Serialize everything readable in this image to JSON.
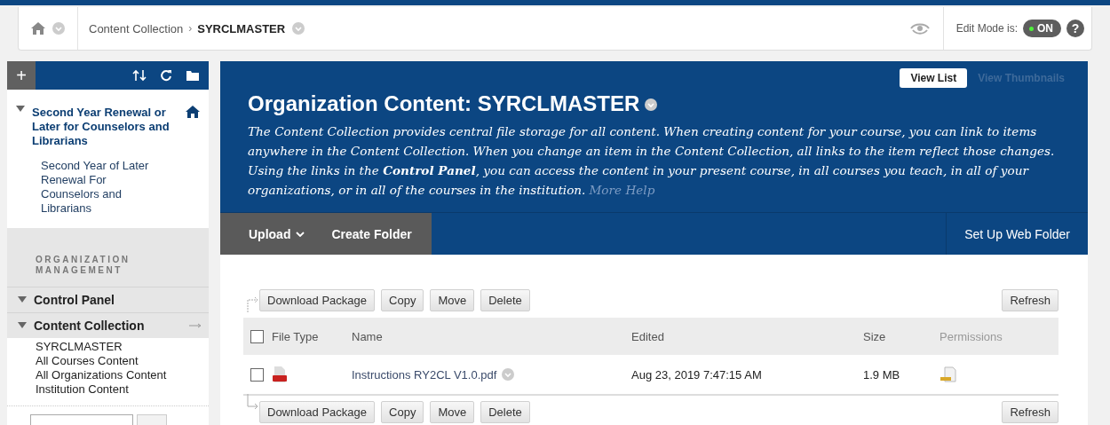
{
  "breadcrumb": {
    "items": [
      "Content Collection",
      "SYRCLMASTER"
    ],
    "separator": "›"
  },
  "edit_mode": {
    "label": "Edit Mode is:",
    "value": "ON",
    "on": true
  },
  "help": "?",
  "sidebar": {
    "add": "+",
    "course": {
      "title": "Second Year Renewal or Later for Counselors and Librarians",
      "expanded": true,
      "link": "Second Year of Later Renewal For Counselors and Librarians"
    },
    "section_label": "ORGANIZATION MANAGEMENT",
    "menus": [
      {
        "label": "Control Panel",
        "expanded": true
      },
      {
        "label": "Content Collection",
        "expanded": true,
        "children": [
          "SYRCLMASTER",
          "All Courses Content",
          "All Organizations Content",
          "Institution Content"
        ]
      }
    ]
  },
  "main": {
    "view_tabs": [
      {
        "label": "View List",
        "selected": true
      },
      {
        "label": "View Thumbnails",
        "selected": false
      }
    ],
    "title": "Organization Content: SYRCLMASTER",
    "description": "The Content Collection provides central file storage for all content. When creating content for your course, you can link to items anywhere in the Content Collection. When you change an item in the Content Collection, all links to the item reflect those changes. Using the links in the **Control Panel**, you can access the content in your present course, in all courses you teach, in all of your organizations, or in all of the courses in the institution.",
    "more_help": "More Help",
    "actions": [
      {
        "label": "Upload",
        "kind": "menu"
      },
      {
        "label": "Create Folder",
        "kind": "button"
      }
    ],
    "web_folder": "Set Up Web Folder",
    "toolbars": [
      {
        "buttons": [
          "Download Package",
          "Copy",
          "Move",
          "Delete"
        ],
        "refresh": "Refresh"
      },
      {
        "buttons": [
          "Download Package",
          "Copy",
          "Move",
          "Delete"
        ],
        "refresh": "Refresh"
      }
    ],
    "select_all_checked": false,
    "columns": [
      "File Type",
      "Name",
      "Edited",
      "Size",
      "Permissions"
    ],
    "rows": [
      {
        "checked": false,
        "name": "Instructions RY2CL V1.0.pdf",
        "edited": "Aug 23, 2019 7:47:15 AM",
        "size": "1.9 MB"
      }
    ]
  }
}
